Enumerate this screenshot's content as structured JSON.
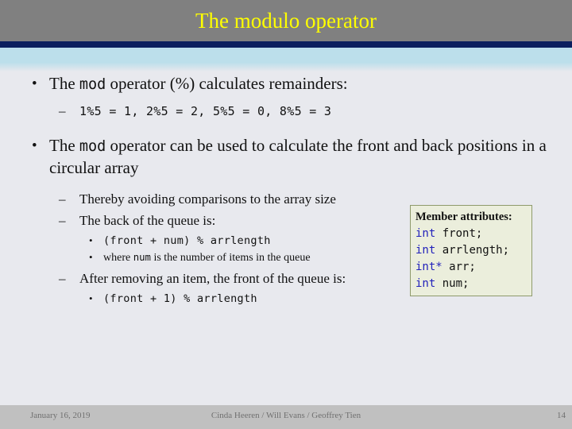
{
  "slide": {
    "title": "The modulo operator",
    "colors": {
      "title_text": "#ffff00",
      "header_gray": "#808080",
      "header_rule_navy": "#0b1f5e",
      "header_light_blue": "#bcdfeb",
      "body_background": "#e8e9ee",
      "footer_band": "#c0c0c0",
      "member_box_fill": "#ebeedc",
      "member_box_border": "#8e9a6b",
      "keyword_blue": "#2222bb"
    }
  },
  "bullets": {
    "b1_pre": "The ",
    "b1_mono": "mod",
    "b1_post": " operator (%) calculates remainders:",
    "b1_marker": "•",
    "b1_sub_marker": "–",
    "b1_sub_code": "1%5 = 1, 2%5 = 2, 5%5 = 0, 8%5 = 3",
    "b2_pre": "The ",
    "b2_mono": "mod",
    "b2_post": " operator can be used to calculate the front and back positions in a circular array",
    "b2_marker": "•",
    "b2_sub1_marker": "–",
    "b2_sub1": "Thereby avoiding comparisons to the array size",
    "b2_sub2_marker": "–",
    "b2_sub2": "The back of the queue is:",
    "b2_sub2_code_marker": "•",
    "b2_sub2_code": "(front + num) % arrlength",
    "b2_sub2_note_marker": "•",
    "b2_sub2_note_pre": "where ",
    "b2_sub2_note_mono": "num",
    "b2_sub2_note_post": " is the number of items in the queue",
    "b2_sub3_marker": "–",
    "b2_sub3": "After removing an item, the front of the queue is:",
    "b2_sub3_code_marker": "•",
    "b2_sub3_code": "(front + 1) % arrlength"
  },
  "member_box": {
    "title": "Member attributes:",
    "lines": [
      {
        "keyword": "int",
        "rest": " front;"
      },
      {
        "keyword": "int",
        "rest": " arrlength;"
      },
      {
        "keyword": "int*",
        "rest": " arr;"
      },
      {
        "keyword": "int",
        "rest": " num;"
      }
    ]
  },
  "footer": {
    "date": "January 16, 2019",
    "authors": "Cinda Heeren / Will Evans / Geoffrey Tien",
    "page_number": "14"
  }
}
